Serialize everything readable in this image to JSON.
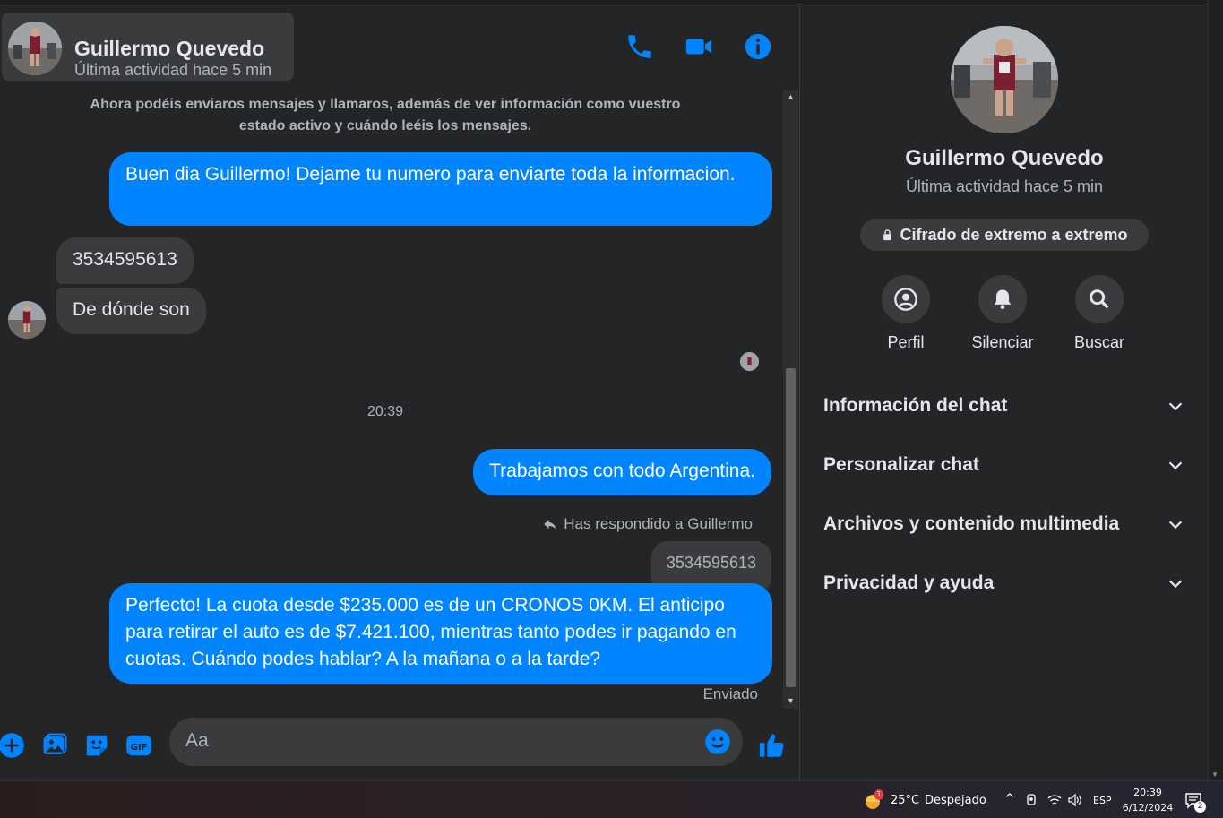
{
  "header": {
    "name": "Guillermo Quevedo",
    "status": "Última actividad hace 5 min"
  },
  "messages": {
    "notice": "Ahora podéis enviaros mensajes y llamaros, además de ver información como vuestro estado activo y cuándo leéis los mensajes.",
    "m1": "Buen dia Guillermo! Dejame tu numero para enviarte toda la informacion.",
    "m2": "3534595613",
    "m3": "De dónde son",
    "time": "20:39",
    "m4": "Trabajamos con todo Argentina.",
    "replied": "Has respondido a Guillermo",
    "quoted": "3534595613",
    "m5": "Perfecto! La cuota desde $235.000 es de un CRONOS 0KM. El anticipo para retirar el auto es de $7.421.100, mientras tanto podes ir pagando en cuotas. Cuándo podes hablar? A la mañana o a la tarde?",
    "sent": "Enviado"
  },
  "composer": {
    "placeholder": "Aa"
  },
  "sidebar": {
    "name": "Guillermo Quevedo",
    "status": "Última actividad hace 5 min",
    "encryption": "Cifrado de extremo a extremo",
    "actions": [
      "Perfil",
      "Silenciar",
      "Buscar"
    ],
    "sections": [
      "Información del chat",
      "Personalizar chat",
      "Archivos y contenido multimedia",
      "Privacidad y ayuda"
    ]
  },
  "taskbar": {
    "weather_badge": "1",
    "weather": "25°C",
    "condition": "Despejado",
    "lang": "ESP",
    "time": "20:39",
    "date": "6/12/2024",
    "notif_count": "2"
  },
  "colors": {
    "accent": "#0084ff",
    "background": "#242526",
    "bubble_in": "#3a3b3c"
  },
  "icons": [
    "phone-icon",
    "video-icon",
    "info-icon",
    "plus-icon",
    "image-icon",
    "sticker-icon",
    "gif-icon",
    "emoji-icon",
    "like-icon",
    "lock-icon",
    "profile-icon",
    "bell-icon",
    "search-icon",
    "chevron-down-icon",
    "reply-icon",
    "weather-icon",
    "wifi-icon",
    "volume-icon",
    "notification-icon"
  ]
}
